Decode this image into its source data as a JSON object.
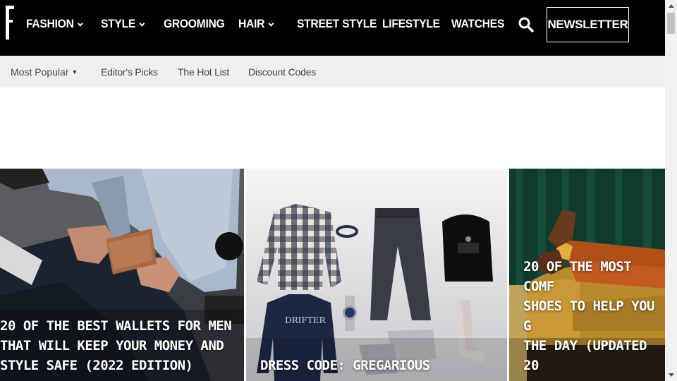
{
  "nav": {
    "items": [
      {
        "label": "FASHION",
        "dropdown": true
      },
      {
        "label": "STYLE",
        "dropdown": true
      },
      {
        "label": "GROOMING",
        "dropdown": false
      },
      {
        "label": "HAIR",
        "dropdown": true
      },
      {
        "label": "STREET STYLE",
        "dropdown": false
      },
      {
        "label": "LIFESTYLE",
        "dropdown": false
      },
      {
        "label": "WATCHES",
        "dropdown": false
      }
    ],
    "newsletter_label": "NEWSLETTER",
    "search_icon": "search-icon"
  },
  "subnav": {
    "items": [
      {
        "label": "Most Popular",
        "dropdown": true
      },
      {
        "label": "Editor's Picks"
      },
      {
        "label": "The Hot List"
      },
      {
        "label": "Discount Codes"
      }
    ]
  },
  "cards": [
    {
      "title": "20 OF THE BEST WALLETS FOR MEN\nTHAT WILL KEEP YOUR MONEY AND\nSTYLE SAFE (2022 EDITION)"
    },
    {
      "title": "DRESS CODE: GREGARIOUS",
      "sweater_text": "DRIFTER"
    },
    {
      "title": "20 OF THE MOST COMF\nSHOES TO HELP YOU G\nTHE DAY (UPDATED 20"
    }
  ],
  "colors": {
    "nav_bg": "#000000",
    "subnav_bg": "#efefef",
    "text_light": "#ffffff"
  }
}
